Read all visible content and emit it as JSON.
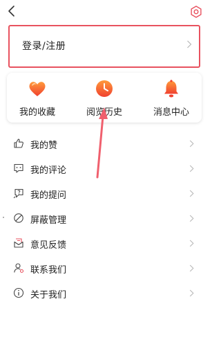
{
  "header": {
    "back_icon": "chevron-left-icon",
    "settings_icon": "gear-icon"
  },
  "login": {
    "label": "登录/注册",
    "highlight_color": "#e8525f"
  },
  "quick_actions": [
    {
      "label": "我的收藏",
      "icon": "heart-icon"
    },
    {
      "label": "阅览历史",
      "icon": "clock-icon"
    },
    {
      "label": "消息中心",
      "icon": "bell-icon"
    }
  ],
  "menu": [
    {
      "label": "我的赞",
      "icon": "thumbs-up-icon"
    },
    {
      "label": "我的评论",
      "icon": "comment-icon"
    },
    {
      "label": "我的提问",
      "icon": "question-chat-icon"
    },
    {
      "label": "屏蔽管理",
      "icon": "block-icon"
    },
    {
      "label": "意见反馈",
      "icon": "feedback-mail-icon"
    },
    {
      "label": "联系我们",
      "icon": "contact-icon"
    },
    {
      "label": "关于我们",
      "icon": "info-icon"
    }
  ],
  "colors": {
    "accent_red": "#e8525f",
    "icon_gradient_start": "#ff9a3c",
    "icon_gradient_end": "#f0412f"
  }
}
